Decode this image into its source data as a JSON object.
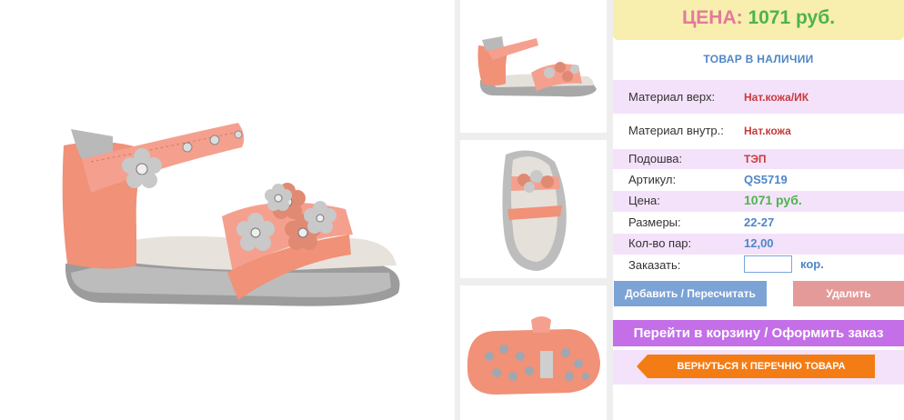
{
  "price_box": {
    "label": "ЦЕНА:",
    "value": "1071 руб."
  },
  "stock_status": "ТОВАР В НАЛИЧИИ",
  "specs": [
    {
      "key": "Материал верх:",
      "value": "Нат.кожа/ИК"
    },
    {
      "key": "Материал внутр.:",
      "value": "Нат.кожа"
    },
    {
      "key": "Подошва:",
      "value": "ТЭП"
    },
    {
      "key": "Артикул:",
      "value": "QS5719"
    },
    {
      "key": "Цена:",
      "value": "1071 руб."
    },
    {
      "key": "Размеры:",
      "value": "22-27"
    },
    {
      "key": "Кол-во пар:",
      "value": "12,00"
    }
  ],
  "order": {
    "label": "Заказать:",
    "value": "",
    "unit": "кор."
  },
  "buttons": {
    "add": "Добавить / Пересчитать",
    "delete": "Удалить",
    "cart": "Перейти в корзину / Оформить заказ",
    "back": "ВЕРНУТЬСЯ К ПЕРЕЧНЮ ТОВАРА"
  },
  "colors": {
    "price_label": "#e27a9c",
    "price_value": "#4db34d",
    "accent_blue": "#4f86c6",
    "row_pink": "#f4e2fb",
    "cart_purple": "#c46fe8",
    "back_orange": "#f47c14",
    "add_blue": "#7ba3d6",
    "delete_pink": "#e59a9a"
  }
}
